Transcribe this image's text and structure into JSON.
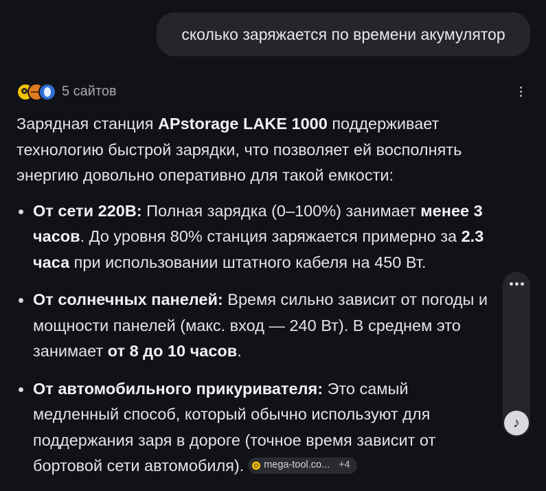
{
  "user_message": "сколько заряжается по времени акумулятор",
  "sources": {
    "count_label": "5 сайтов",
    "icons": [
      "source-favicon-1",
      "source-favicon-2",
      "source-favicon-3"
    ]
  },
  "answer": {
    "intro": [
      {
        "t": "Зарядная станция "
      },
      {
        "t": "APstorage LAKE 1000",
        "b": true
      },
      {
        "t": " поддерживает технологию быстрой зарядки, что позволяет ей восполнять энергию довольно оперативно для такой емкости:"
      }
    ],
    "bullets": [
      [
        {
          "t": "От сети 220В:",
          "b": true
        },
        {
          "t": " Полная зарядка (0–100%) занимает "
        },
        {
          "t": "менее 3 часов",
          "b": true
        },
        {
          "t": ". До уровня 80% станция заряжается примерно за "
        },
        {
          "t": "2.3 часа",
          "b": true
        },
        {
          "t": " при использовании штатного кабеля на 450 Вт."
        }
      ],
      [
        {
          "t": "От солнечных панелей:",
          "b": true
        },
        {
          "t": " Время сильно зависит от погоды и мощности панелей (макс. вход — 240 Вт). В среднем это занимает "
        },
        {
          "t": "от 8 до 10 часов",
          "b": true
        },
        {
          "t": "."
        }
      ],
      [
        {
          "t": "От автомобильного прикуривателя:",
          "b": true
        },
        {
          "t": " Это самый медленный способ, который обычно используют для поддержания заря в дороге (точное время зависит от бортовой сети автомобиля)."
        }
      ]
    ],
    "citation": {
      "domain": "mega-tool.co...",
      "extra": "+4"
    }
  },
  "controls": {
    "more_icon": "more-vertical-icon",
    "panel_icon": "more-horizontal-icon",
    "music_glyph": "♪"
  }
}
